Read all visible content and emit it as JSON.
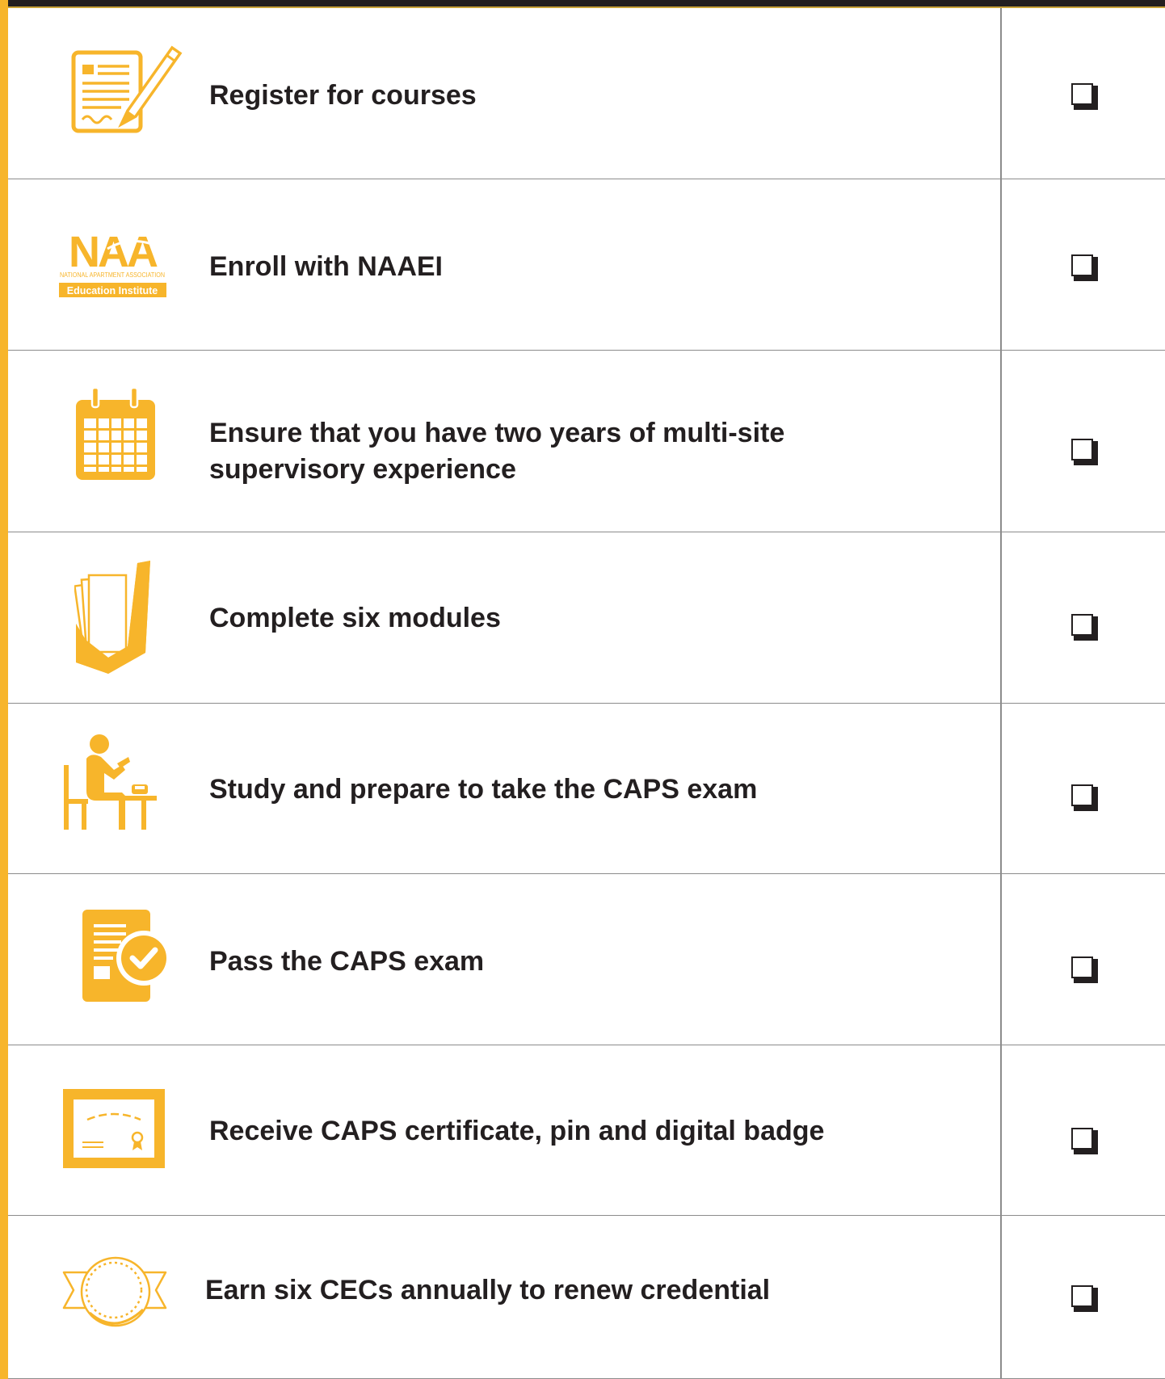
{
  "colors": {
    "accent": "#f7b52b",
    "text": "#231f20",
    "rule": "#8c8c8c"
  },
  "logo": {
    "wordmark": "NAA",
    "tagline": "NATIONAL APARTMENT ASSOCIATION",
    "band": "Education Institute"
  },
  "steps": [
    {
      "icon": "form-pencil-icon",
      "label": "Register for courses",
      "checked": false
    },
    {
      "icon": "naa-logo",
      "label": "Enroll with NAAEI",
      "checked": false
    },
    {
      "icon": "calendar-icon",
      "label": "Ensure that you have two years of multi-site supervisory experience",
      "checked": false
    },
    {
      "icon": "file-holder-icon",
      "label": "Complete six modules",
      "checked": false
    },
    {
      "icon": "person-studying-icon",
      "label": "Study and prepare to take the CAPS exam",
      "checked": false
    },
    {
      "icon": "document-check-icon",
      "label": "Pass the CAPS exam",
      "checked": false
    },
    {
      "icon": "certificate-icon",
      "label": "Receive CAPS certificate, pin and digital badge",
      "checked": false
    },
    {
      "icon": "coin-ribbon-icon",
      "label": "Earn six CECs annually to renew credential",
      "checked": false
    }
  ]
}
